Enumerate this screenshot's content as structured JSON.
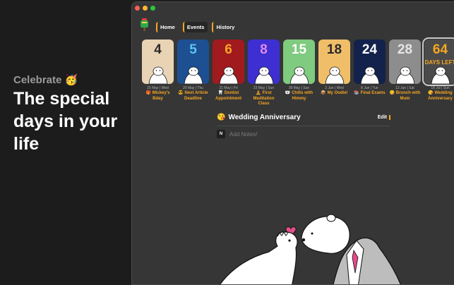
{
  "promo": {
    "kicker": "Celebrate",
    "kicker_emoji": "🥳",
    "headline": "The special days in your life"
  },
  "window": {
    "traffic_lights": {
      "close": "#ff5f57",
      "minimize": "#febc2e",
      "zoom": "#28c840"
    },
    "nav": [
      {
        "label": "Home",
        "active": false
      },
      {
        "label": "Events",
        "active": true
      },
      {
        "label": "History",
        "active": false
      }
    ]
  },
  "accent": "#f5a623",
  "events": [
    {
      "number": "4",
      "date": "15 May | Wed",
      "emoji": "🎁",
      "title": "Mickey's Bday",
      "bg": "#e8d4b4",
      "num_color": "#2a2a2a",
      "icon": "gift-icon"
    },
    {
      "number": "5",
      "date": "20 May | Thu",
      "emoji": "😎",
      "title": "Next Article Deadline",
      "bg": "#1d4f93",
      "num_color": "#5ec4ef",
      "icon": "sunglasses-icon"
    },
    {
      "number": "6",
      "date": "21 May | Fri",
      "emoji": "🦷",
      "title": "Dentist Appointment",
      "bg": "#a11a1e",
      "num_color": "#f5a623",
      "icon": "tooth-icon"
    },
    {
      "number": "8",
      "date": "23 May | Sun",
      "emoji": "🧘",
      "title": "First Meditation Class",
      "bg": "#3d2fd2",
      "num_color": "#e08aee",
      "icon": "meditation-icon"
    },
    {
      "number": "15",
      "date": "30 May | Sun",
      "emoji": "🐻‍❄️",
      "title": "Chills with Himmy",
      "bg": "#7fcb7f",
      "num_color": "#ffffff",
      "icon": "polar-bear-icon"
    },
    {
      "number": "18",
      "date": "2 Jun | Wed",
      "emoji": "📦",
      "title": "My Oodie!",
      "bg": "#f0be68",
      "num_color": "#2a2a2a",
      "icon": "package-icon"
    },
    {
      "number": "24",
      "date": "8 Jun | Tue",
      "emoji": "📚",
      "title": "Final Exams",
      "bg": "#12224c",
      "num_color": "#ffffff",
      "icon": "books-icon"
    },
    {
      "number": "28",
      "date": "12 Jun | Sat",
      "emoji": "😋",
      "title": "Brunch with Mum",
      "bg": "#8d8d8d",
      "num_color": "#e6e6e6",
      "icon": "yum-icon"
    },
    {
      "number": "64",
      "date": "18 Jul | Sun",
      "emoji": "😘",
      "title": "Wedding Anniversary",
      "bg": "#4a4a4a",
      "num_color": "#f5a623",
      "icon": "kiss-icon",
      "extra": "DAYS LEFT",
      "selected": true
    }
  ],
  "detail": {
    "emoji": "😘",
    "title": "Wedding Anniversary",
    "edit_label": "Edit",
    "notes_icon_letter": "N",
    "notes_placeholder": "Add Notes!"
  }
}
